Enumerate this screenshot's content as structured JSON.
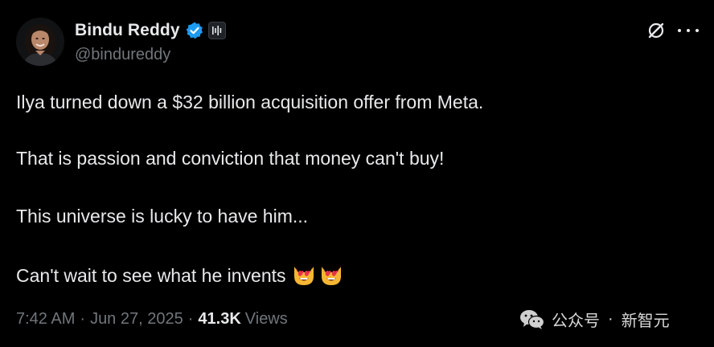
{
  "author": {
    "display_name": "Bindu Reddy",
    "handle": "@bindureddy",
    "verified": true,
    "verified_color": "#1d9bf0",
    "avatar_icon": "profile-photo"
  },
  "header_actions": {
    "grok_icon": "grok-slash-circle-icon",
    "more_icon": "more-horizontal-icon"
  },
  "tweet": {
    "lines": [
      "Ilya turned down a $32 billion acquisition offer from Meta.",
      "That is passion and conviction that money can't buy!",
      "This universe is lucky to have him...",
      "Can't wait to see what he invents"
    ],
    "emojis": [
      "heart-eyes-cat-emoji",
      "heart-eyes-cat-emoji"
    ]
  },
  "meta": {
    "time": "7:42 AM",
    "date": "Jun 27, 2025",
    "separator": "·",
    "views_count": "41.3K",
    "views_label": "Views"
  },
  "watermark": {
    "source": "公众号",
    "dot": "·",
    "name": "新智元",
    "icon": "wechat-icon"
  },
  "colors": {
    "background": "#000000",
    "text_primary": "#e7e9ea",
    "text_secondary": "#71767b",
    "accent": "#1d9bf0"
  }
}
